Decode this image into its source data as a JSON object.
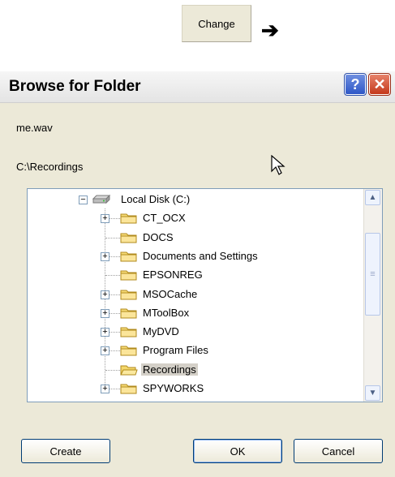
{
  "header": {
    "change_label": "Change",
    "arrow_glyph": "➔"
  },
  "dialog": {
    "title": "Browse for Folder",
    "help_glyph": "?",
    "close_glyph": "✕",
    "filename": "me.wav",
    "path": "C:\\Recordings",
    "tree": {
      "root": "Local Disk (C:)",
      "items": [
        {
          "label": "CT_OCX",
          "expandable": true
        },
        {
          "label": "DOCS",
          "expandable": false
        },
        {
          "label": "Documents and Settings",
          "expandable": true
        },
        {
          "label": "EPSONREG",
          "expandable": false
        },
        {
          "label": "MSOCache",
          "expandable": true
        },
        {
          "label": "MToolBox",
          "expandable": true
        },
        {
          "label": "MyDVD",
          "expandable": true
        },
        {
          "label": "Program Files",
          "expandable": true
        },
        {
          "label": "Recordings",
          "expandable": false,
          "selected": true
        },
        {
          "label": "SPYWORKS",
          "expandable": true
        }
      ]
    },
    "buttons": {
      "create": "Create",
      "ok": "OK",
      "cancel": "Cancel"
    }
  }
}
